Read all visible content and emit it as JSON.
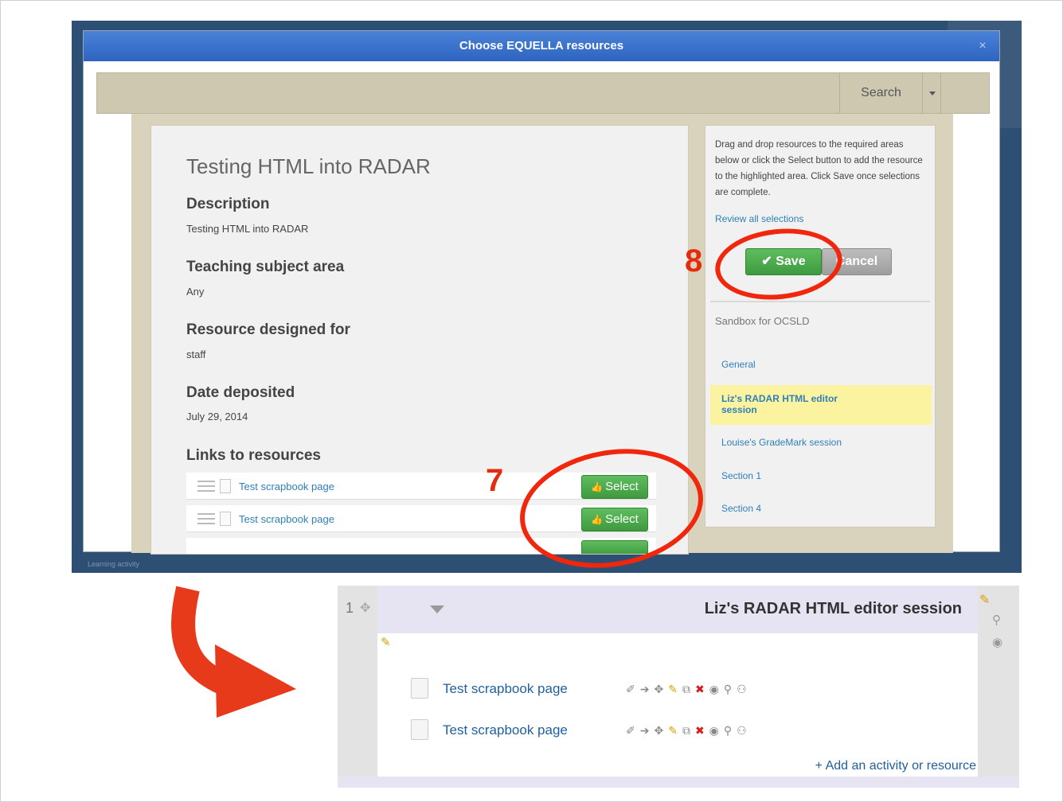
{
  "modal": {
    "title": "Choose EQUELLA resources",
    "close_label": "×",
    "backdrop_caption": "Learning activity"
  },
  "toolbar": {
    "search_label": "Search"
  },
  "item": {
    "title": "Testing HTML into RADAR",
    "fields": [
      {
        "label": "Description",
        "value": "Testing HTML into RADAR"
      },
      {
        "label": "Teaching subject area",
        "value": "Any"
      },
      {
        "label": "Resource designed for",
        "value": "staff"
      },
      {
        "label": "Date deposited",
        "value": "July 29, 2014"
      }
    ],
    "links_heading": "Links to resources",
    "resources": [
      {
        "name": "Test scrapbook page",
        "select_label": "Select"
      },
      {
        "name": "Test scrapbook page",
        "select_label": "Select"
      }
    ]
  },
  "sidebar": {
    "help_text": "Drag and drop resources to the required areas below or click the Select button to add the resource to the highlighted area. Click Save once selections are complete.",
    "review_label": "Review all selections",
    "save_label": "Save",
    "cancel_label": "Cancel",
    "course_name": "Sandbox for OCSLD",
    "sections": [
      {
        "label": "General",
        "active": false
      },
      {
        "label": "Liz's RADAR HTML editor session",
        "active": true
      },
      {
        "label": "Louise's GradeMark session",
        "active": false
      },
      {
        "label": "Section 1",
        "active": false
      },
      {
        "label": "Section 4",
        "active": false
      }
    ]
  },
  "annotations": {
    "step_select": "7",
    "step_save": "8",
    "highlight_color": "#f1270d"
  },
  "course_section": {
    "number": "1",
    "title": "Liz's RADAR HTML editor session",
    "activities": [
      {
        "name": "Test scrapbook page"
      },
      {
        "name": "Test scrapbook page"
      }
    ],
    "add_activity_label": "Add an activity or resource"
  },
  "colors": {
    "accent_blue": "#2d64c0",
    "select_green": "#3f9a3f",
    "highlight_yellow": "#fbf3a0",
    "arrow_red": "#e63a1b"
  }
}
